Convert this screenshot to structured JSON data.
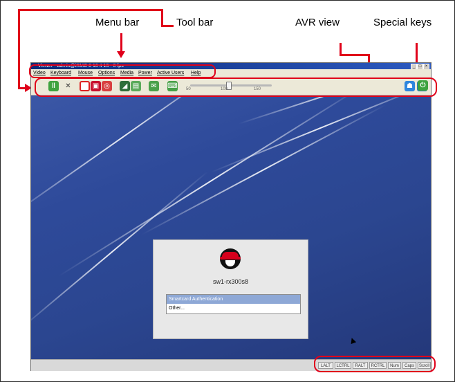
{
  "callouts": {
    "menu_bar": "Menu bar",
    "tool_bar": "Tool bar",
    "avr_view": "AVR view",
    "special_keys": "Special keys"
  },
  "window": {
    "title": "Viewer - admin@iRMC 8 10 4 13 - 0 fps",
    "menu": [
      "Video",
      "Keyboard",
      "Mouse",
      "Options",
      "Media",
      "Power",
      "Active Users",
      "Help"
    ]
  },
  "toolbar": {
    "slider_ticks": [
      "50",
      "100",
      "150"
    ],
    "slider_value": 100,
    "icons_left": [
      "pause-icon",
      "tools-icon",
      "record-icon",
      "floppy-icon",
      "cd-icon",
      "drive-icon",
      "screen-icon",
      "chat-icon",
      "keyboard-icon"
    ],
    "icons_right": [
      "user-icon",
      "monitor-icon",
      "power-icon"
    ]
  },
  "login": {
    "hostname": "sw1-rx300s8",
    "options": [
      "Smartcard Authentication",
      "Other..."
    ]
  },
  "special_keys": [
    "LALT",
    "LCTRL",
    "RALT",
    "RCTRL",
    "Num",
    "Caps",
    "Scroll"
  ],
  "colors": {
    "annotation": "#e0001a",
    "desktop": "#2e4a9a",
    "title_bar": "#0c2a78"
  }
}
